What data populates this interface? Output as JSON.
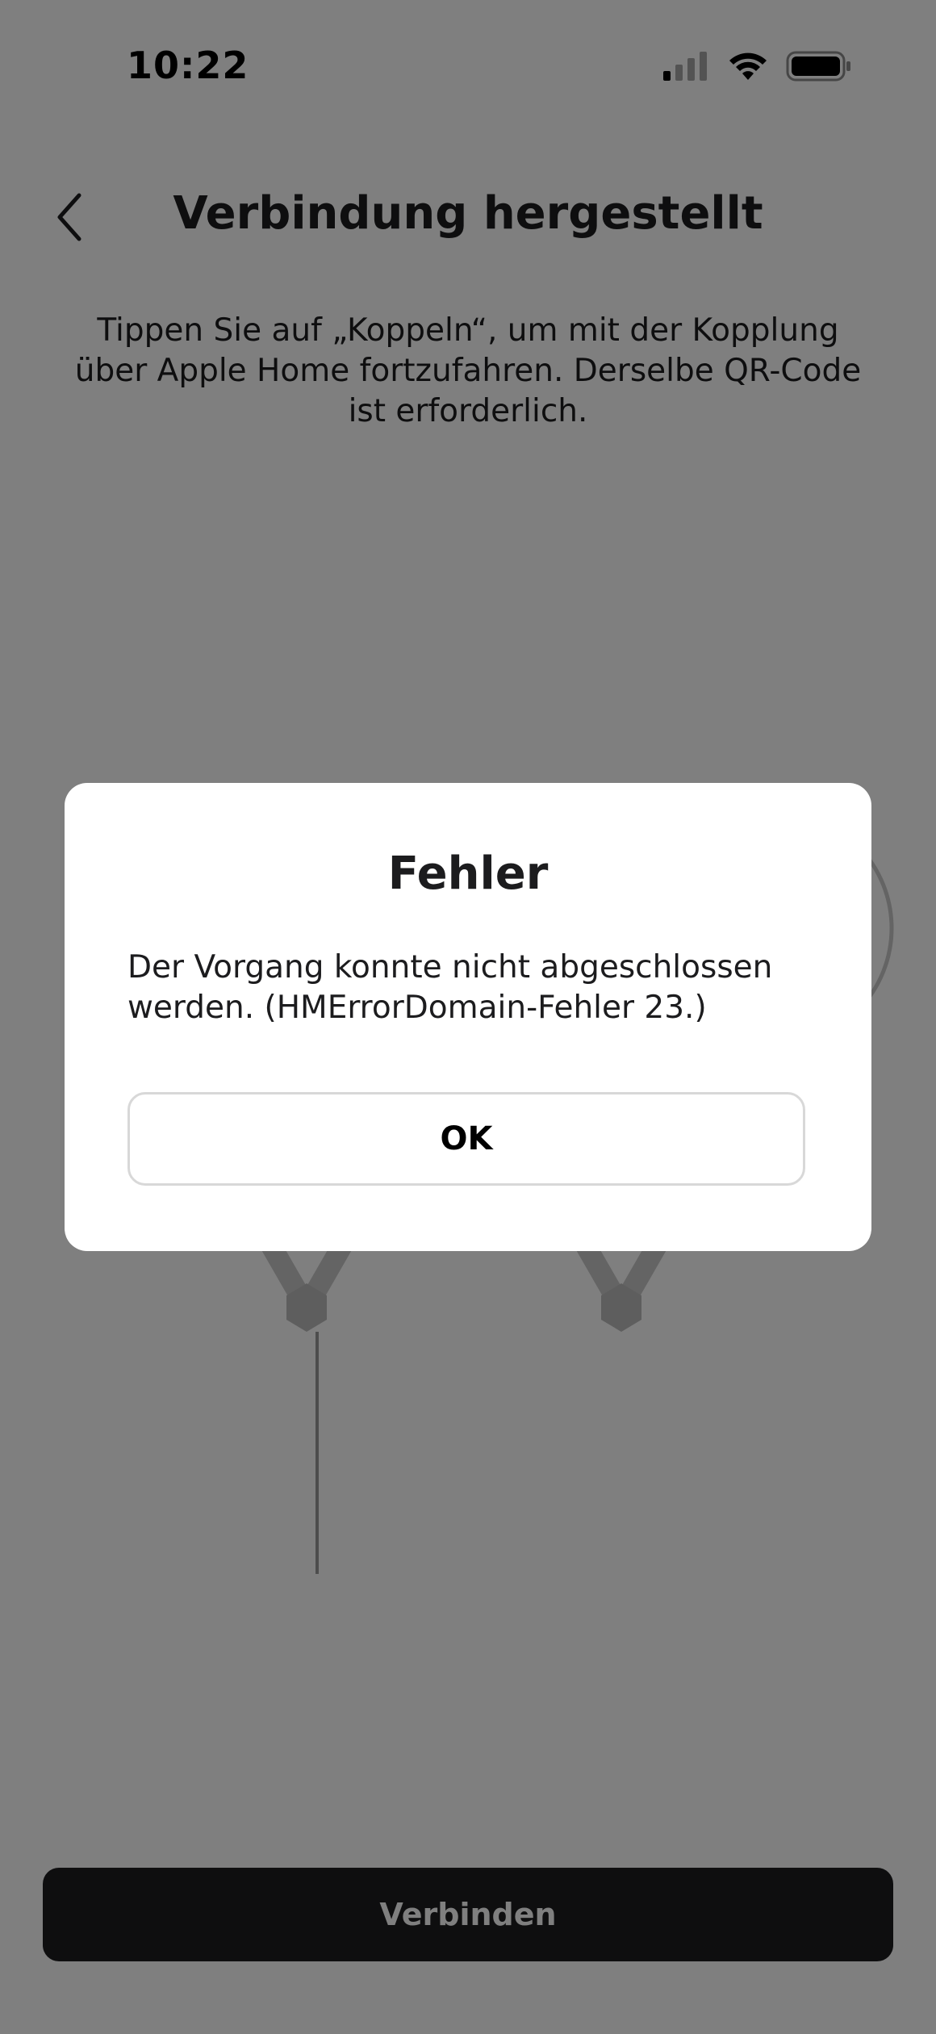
{
  "status_bar": {
    "time": "10:22",
    "icons": [
      "cell-signal-icon",
      "wifi-icon",
      "battery-icon"
    ]
  },
  "header": {
    "back_icon": "chevron-left-icon",
    "title": "Verbindung hergestellt"
  },
  "main": {
    "description": "Tippen Sie auf „Koppeln“, um mit der Kopplung über Apple Home fortzufahren. Derselbe QR-Code ist erforderlich.",
    "illustration": "light-panels-illustration"
  },
  "footer": {
    "connect_label": "Verbinden"
  },
  "dialog": {
    "title": "Fehler",
    "message": "Der Vorgang konnte nicht abgeschlossen werden. (HMErrorDomain-Fehler 23.)",
    "ok_label": "OK"
  },
  "colors": {
    "overlay": "#000000",
    "button_dark": "#1c1c1e",
    "text_primary": "#1c1c1e",
    "dialog_bg": "#ffffff"
  }
}
